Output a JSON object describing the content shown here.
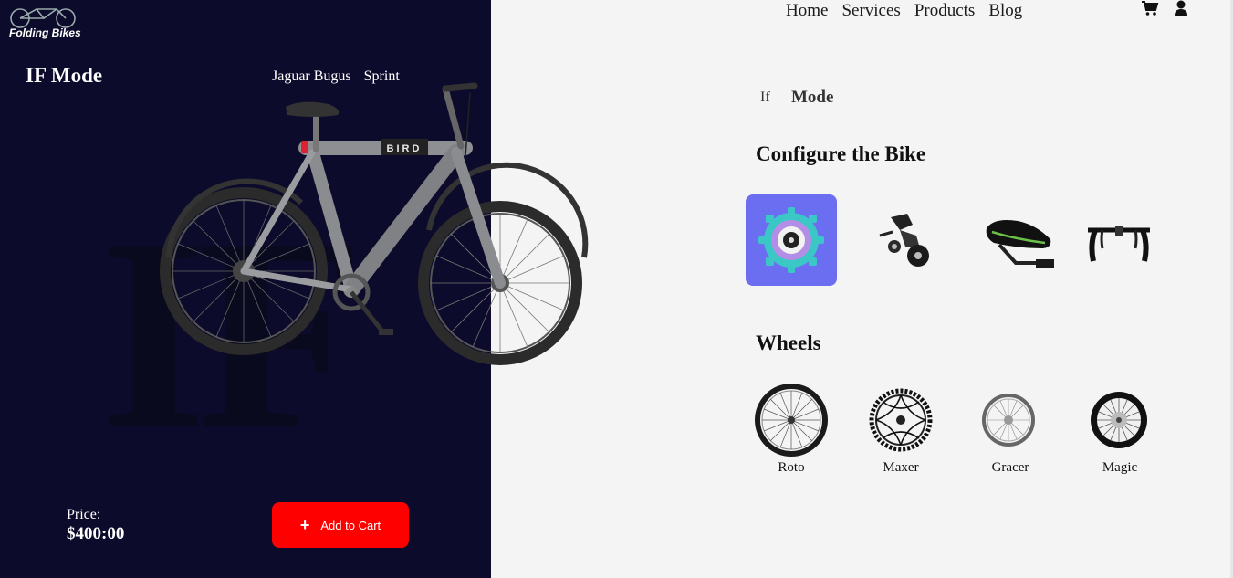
{
  "brand": {
    "name": "Folding Bikes"
  },
  "header": {
    "nav": [
      "Home",
      "Services",
      "Products",
      "Blog"
    ]
  },
  "hero": {
    "title": "IF Mode",
    "variants": [
      "Jaguar Bugus",
      "Sprint"
    ],
    "frame_text": "BIRD",
    "price_label": "Price:",
    "price_value": "$400:00",
    "cart_button": "Add to Cart"
  },
  "config": {
    "mode_sub": "If",
    "mode_main": "Mode",
    "configure_heading": "Configure the Bike",
    "parts": [
      "gear-sprocket",
      "derailleur",
      "saddle",
      "handlebar"
    ],
    "active_part": "gear-sprocket",
    "wheels_heading": "Wheels",
    "wheels": [
      "Roto",
      "Maxer",
      "Gracer",
      "Magic"
    ]
  },
  "colors": {
    "left_bg": "#0c0b2b",
    "right_bg": "#f4f4f4",
    "accent": "#ff0000",
    "active_tile": "#6b6ef0"
  }
}
